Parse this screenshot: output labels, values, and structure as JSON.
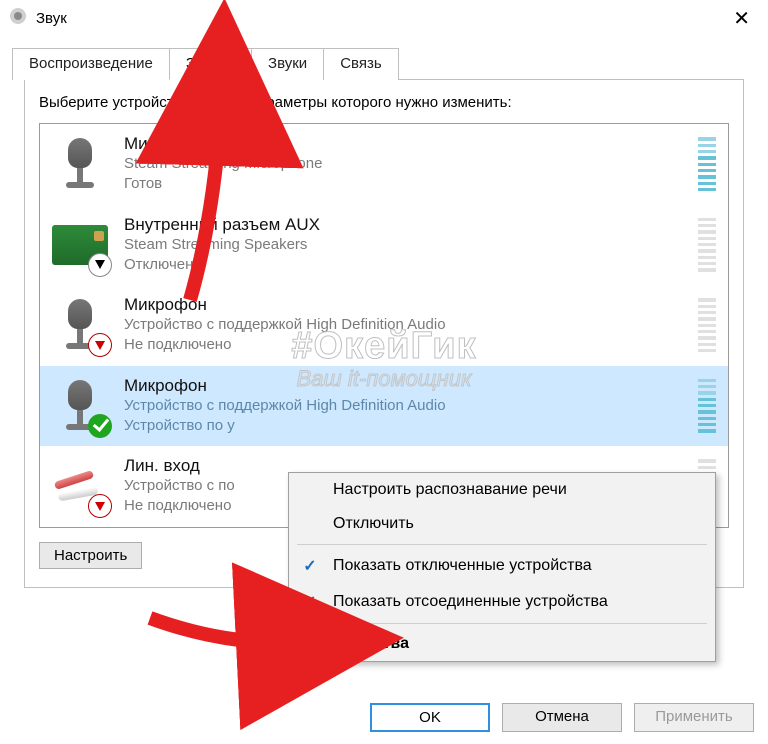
{
  "window": {
    "title": "Звук"
  },
  "tabs": {
    "playback": "Воспроизведение",
    "recording": "Запись",
    "sounds": "Звуки",
    "comm": "Связь"
  },
  "instruction": "Выберите устройство записи, параметры которого нужно изменить:",
  "devices": [
    {
      "name": "Микрофон",
      "sub1": "Steam Streaming Microphone",
      "sub2": "Готов",
      "icon": "mic",
      "badge": "",
      "selected": false,
      "level": true
    },
    {
      "name": "Внутренний разъем  AUX",
      "sub1": "Steam Streaming Speakers",
      "sub2": "Отключено",
      "icon": "card",
      "badge": "down",
      "selected": false,
      "level": false
    },
    {
      "name": "Микрофон",
      "sub1": "Устройство с поддержкой High Definition Audio",
      "sub2": "Не подключено",
      "icon": "mic",
      "badge": "red",
      "selected": false,
      "level": false
    },
    {
      "name": "Микрофон",
      "sub1": "Устройство с поддержкой High Definition Audio",
      "sub2": "Устройство по у",
      "icon": "mic",
      "badge": "green",
      "selected": true,
      "level": true
    },
    {
      "name": "Лин. вход",
      "sub1": "Устройство с по",
      "sub2": "Не подключено",
      "icon": "jack",
      "badge": "red",
      "selected": false,
      "level": false
    }
  ],
  "configure_btn": "Настроить",
  "context_menu": {
    "configure_speech": "Настроить распознавание речи",
    "disable": "Отключить",
    "show_disabled": "Показать отключенные устройства",
    "show_disconnected": "Показать отсоединенные устройства",
    "properties": "Свойства"
  },
  "dialog_buttons": {
    "ok": "OK",
    "cancel": "Отмена",
    "apply": "Применить"
  },
  "watermark": {
    "line1": "#ОкейГик",
    "line2": "Ваш it-помощник"
  }
}
